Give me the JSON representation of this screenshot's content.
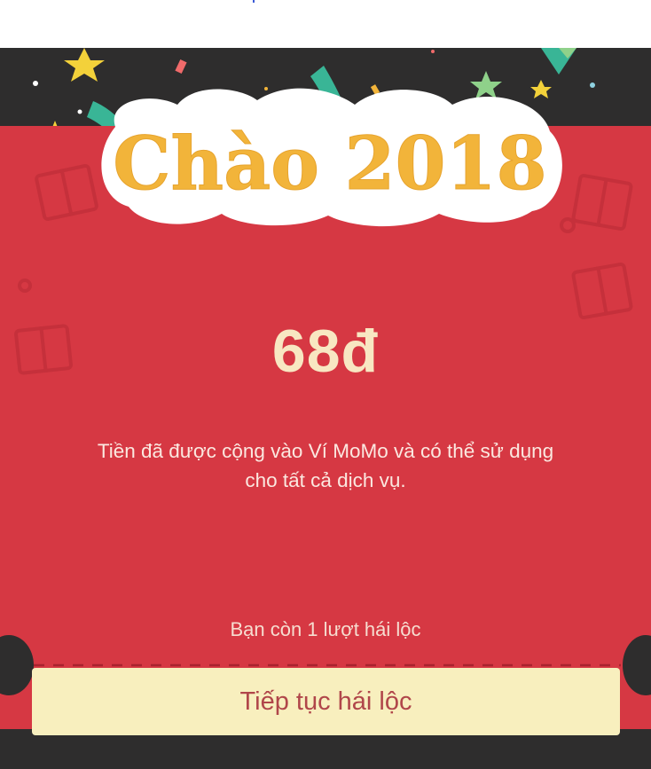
{
  "greeting": {
    "title": "Chào 2018"
  },
  "reward": {
    "amount": "68đ",
    "description_line1": "Tiền đã được cộng vào Ví MoMo và có thể sử dụng",
    "description_line2": "cho tất cả dịch vụ."
  },
  "footer": {
    "turns_left": "Bạn còn 1 lượt hái lộc",
    "continue_label": "Tiếp tục hái lộc"
  },
  "colors": {
    "background_dark": "#2e2d2d",
    "card_red": "#d63843",
    "title_gold": "#f2b43a",
    "button_cream": "#f8efbe",
    "button_text": "#b0464a"
  }
}
